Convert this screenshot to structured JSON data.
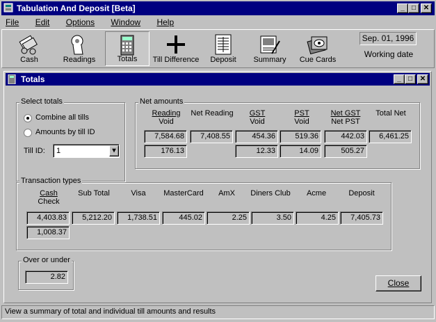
{
  "app": {
    "title": "Tabulation And Deposit  [Beta]"
  },
  "menu": [
    "File",
    "Edit",
    "Options",
    "Window",
    "Help"
  ],
  "toolbar": [
    {
      "label": "Cash",
      "icon": "cash-icon"
    },
    {
      "label": "Readings",
      "icon": "readings-icon"
    },
    {
      "label": "Totals",
      "icon": "calculator-icon"
    },
    {
      "label": "Till Difference",
      "icon": "plus-icon"
    },
    {
      "label": "Deposit",
      "icon": "deposit-slip-icon"
    },
    {
      "label": "Summary",
      "icon": "summary-icon"
    },
    {
      "label": "Cue Cards",
      "icon": "cue-cards-icon"
    }
  ],
  "working_date": {
    "value": "Sep. 01, 1996",
    "label": "Working date"
  },
  "child": {
    "title": "Totals"
  },
  "select_totals": {
    "label": "Select totals",
    "combine": "Combine all tills",
    "by_till": "Amounts by till ID",
    "till_id_label": "Till ID:",
    "till_id_value": "1"
  },
  "net_amounts": {
    "label": "Net amounts",
    "headers": [
      {
        "top": "Reading",
        "bottom": "Void"
      },
      {
        "top": "Net Reading",
        "bottom": ""
      },
      {
        "top": "GST",
        "bottom": "Void"
      },
      {
        "top": "PST",
        "bottom": "Void"
      },
      {
        "top": "Net GST",
        "bottom": "Net PST"
      },
      {
        "top": "Total Net",
        "bottom": ""
      }
    ],
    "row1": [
      "7,584.68",
      "7,408.55",
      "454.36",
      "519.36",
      "442.03",
      "6,461.25"
    ],
    "row2": [
      "176.13",
      "12.33",
      "14.09",
      "505.27"
    ]
  },
  "transaction_types": {
    "label": "Transaction types",
    "headers": [
      {
        "top": "Cash",
        "bottom": "Check"
      },
      {
        "top": "Sub Total",
        "bottom": ""
      },
      {
        "top": "Visa",
        "bottom": ""
      },
      {
        "top": "MasterCard",
        "bottom": ""
      },
      {
        "top": "AmX",
        "bottom": ""
      },
      {
        "top": "Diners Club",
        "bottom": ""
      },
      {
        "top": "Acme",
        "bottom": ""
      },
      {
        "top": "Deposit",
        "bottom": ""
      }
    ],
    "row1": [
      "4,403.83",
      "5,212.20",
      "1,738.51",
      "445.02",
      "2.25",
      "3.50",
      "4.25",
      "7,405.73"
    ],
    "row2": [
      "1,008.37"
    ]
  },
  "over_under": {
    "label": "Over or under",
    "value": "2.82"
  },
  "close_label": "Close",
  "status": "View a summary of total and individual till amounts and results"
}
